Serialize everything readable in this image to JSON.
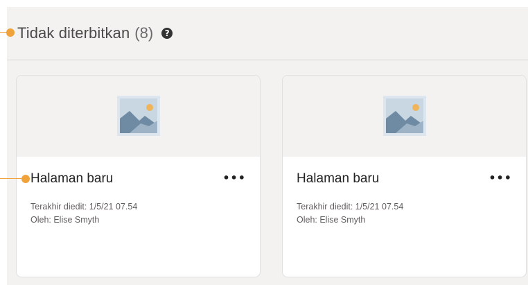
{
  "section": {
    "title": "Tidak diterbitkan",
    "count": "(8)",
    "help_icon": "question-circle-icon"
  },
  "cards": [
    {
      "title": "Halaman baru",
      "more_label": "•••",
      "last_edited": "Terakhir diedit: 1/5/21 07.54",
      "author": "Oleh: Elise Smyth",
      "thumbnail_icon": "image-placeholder-icon"
    },
    {
      "title": "Halaman baru",
      "more_label": "•••",
      "last_edited": "Terakhir diedit: 1/5/21 07.54",
      "author": "Oleh: Elise Smyth",
      "thumbnail_icon": "image-placeholder-icon"
    }
  ],
  "colors": {
    "callout": "#f0a33b",
    "background": "#f3f2f1",
    "card": "#ffffff"
  }
}
